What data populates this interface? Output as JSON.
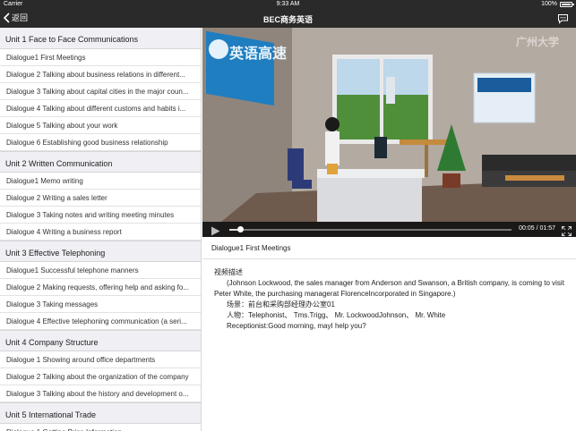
{
  "status_bar": {
    "carrier": "Carrier",
    "time": "9:33 AM",
    "battery": "100%"
  },
  "nav": {
    "back_label": "返回",
    "title": "BEC商务英语"
  },
  "sidebar": {
    "units": [
      {
        "title": "Unit 1  Face to Face Communications",
        "dialogues": [
          "Dialogue1  First Meetings",
          "Dialogue 2  Talking about business relations in different...",
          "Dialogue 3   Talking about capital cities in the major coun...",
          "Dialogue 4   Talking about different customs and habits i...",
          "Dialogue 5   Talking about your work",
          "Dialogue 6   Establishing good business relationship"
        ]
      },
      {
        "title": "Unit 2  Written Communication",
        "dialogues": [
          "Dialogue1  Memo writing",
          "Dialogue 2  Writing a sales letter",
          "Dialogue 3 Taking notes and writing meeting minutes",
          "Dialogue 4 Writing a business report"
        ]
      },
      {
        "title": "Unit 3 Effective Telephoning",
        "dialogues": [
          "Dialogue1  Successful telephone manners",
          "Dialogue 2  Making requests, offering help and asking fo...",
          "Dialogue 3  Taking messages",
          "Dialogue 4  Effective telephoning communication (a seri..."
        ]
      },
      {
        "title": "Unit 4  Company Structure",
        "dialogues": [
          "Dialogue 1 Showing around office departments",
          "Dialogue 2  Talking about the organization of the company",
          "Dialogue 3  Talking about the history and development o..."
        ]
      },
      {
        "title": "Unit 5  International Trade",
        "dialogues": [
          "Dialogue 1 Getting Price Information"
        ]
      }
    ]
  },
  "video": {
    "watermark": "广州大学",
    "logo_text": "英语高速",
    "current_time": "00:05",
    "total_time": "01:57",
    "progress": 0.04
  },
  "content": {
    "title": "Dialogue1   First Meetings",
    "section_label": "视频描述",
    "description": "(Johnson Lockwood, the sales manager from Anderson and Swanson, a British company, is coming to visit Peter White, the purchasing managerat FlorenceIncorporated in Singapore.)",
    "scene": "场景：前台和采购部经理办公室01",
    "people": "人物：Telephonist、 Tms.Trigg、 Mr. LockwoodJohnson、 Mr. White",
    "first_line": "Receptionist:Good morning, mayI help you?"
  }
}
